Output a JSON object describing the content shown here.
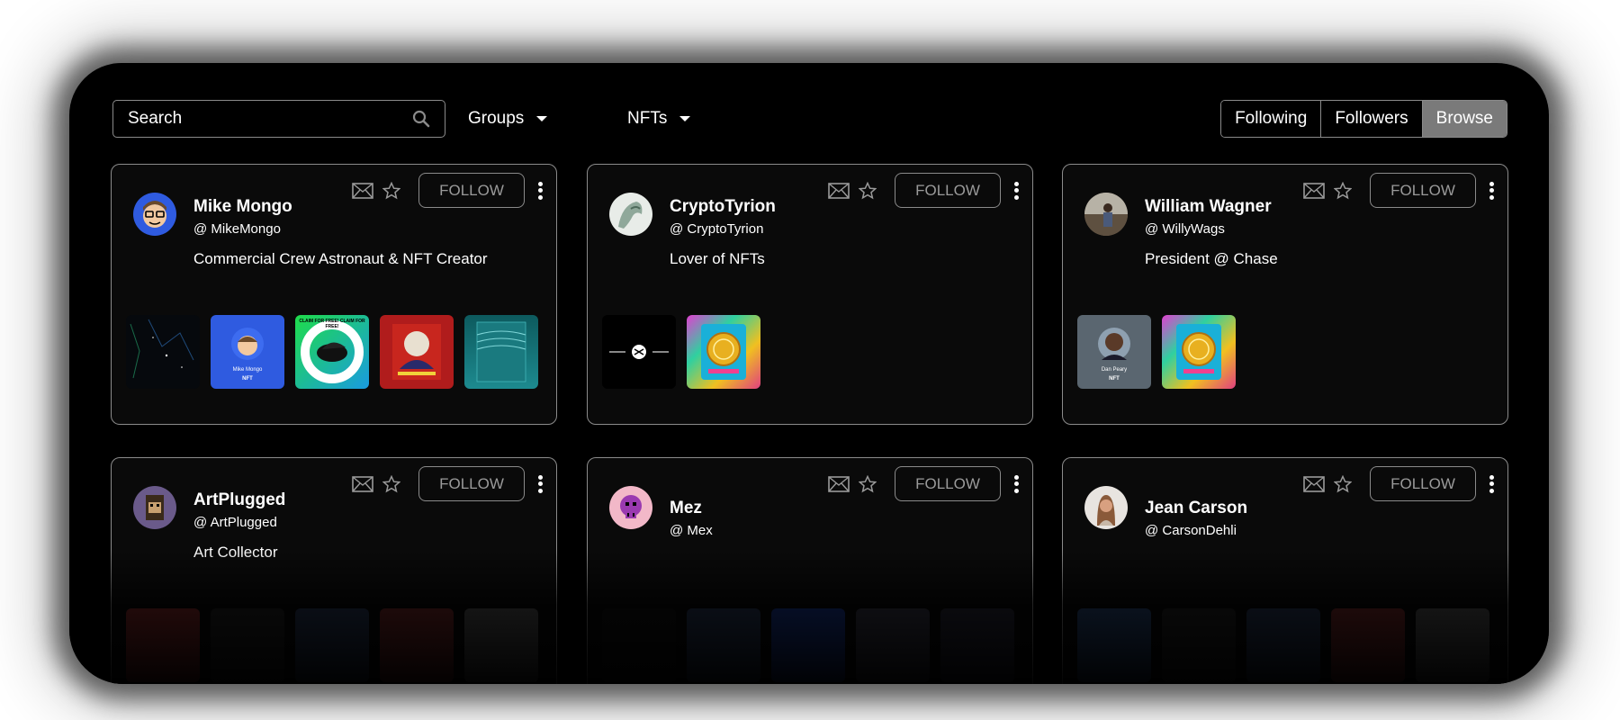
{
  "search": {
    "placeholder": "Search"
  },
  "filters": {
    "groups_label": "Groups",
    "nfts_label": "NFTs"
  },
  "tabs": [
    {
      "label": "Following",
      "active": false
    },
    {
      "label": "Followers",
      "active": false
    },
    {
      "label": "Browse",
      "active": true
    }
  ],
  "follow_label": "FOLLOW",
  "profiles": [
    {
      "name": "Mike Mongo",
      "handle": "@ MikeMongo",
      "bio": "Commercial Crew Astronaut & NFT Creator",
      "nfts": [
        "space-poster",
        "mike-mongo-nft",
        "claim-for-free-cap",
        "red-art-poster",
        "teal-wave-poster"
      ]
    },
    {
      "name": "CryptoTyrion",
      "handle": "@ CryptoTyrion",
      "bio": "Lover of NFTs",
      "nfts": [
        "black-logo-banner",
        "psychedelic-coin-card"
      ]
    },
    {
      "name": "William Wagner",
      "handle": "@ WillyWags",
      "bio": "President @ Chase",
      "nfts": [
        "dan-peary-nft",
        "psychedelic-coin-card"
      ]
    },
    {
      "name": "ArtPlugged",
      "handle": "@ ArtPlugged",
      "bio": "Art Collector",
      "nfts": []
    },
    {
      "name": "Mez",
      "handle": "@ Mex",
      "bio": "",
      "nfts": []
    },
    {
      "name": "Jean Carson",
      "handle": "@ CarsonDehli",
      "bio": "",
      "nfts": []
    }
  ],
  "nft_text": {
    "mike_mongo_name": "Mike Mongo",
    "mike_mongo_tag": "NFT",
    "claim_text": "CLAIM FOR FREE! CLAIM FOR FREE!",
    "dan_peary_name": "Dan Peary",
    "dan_peary_tag": "NFT"
  },
  "colors": {
    "background": "#000000",
    "card_border": "#8b8b8b",
    "active_tab": "#7a7a7a",
    "accent_blue": "#2f5be0"
  }
}
